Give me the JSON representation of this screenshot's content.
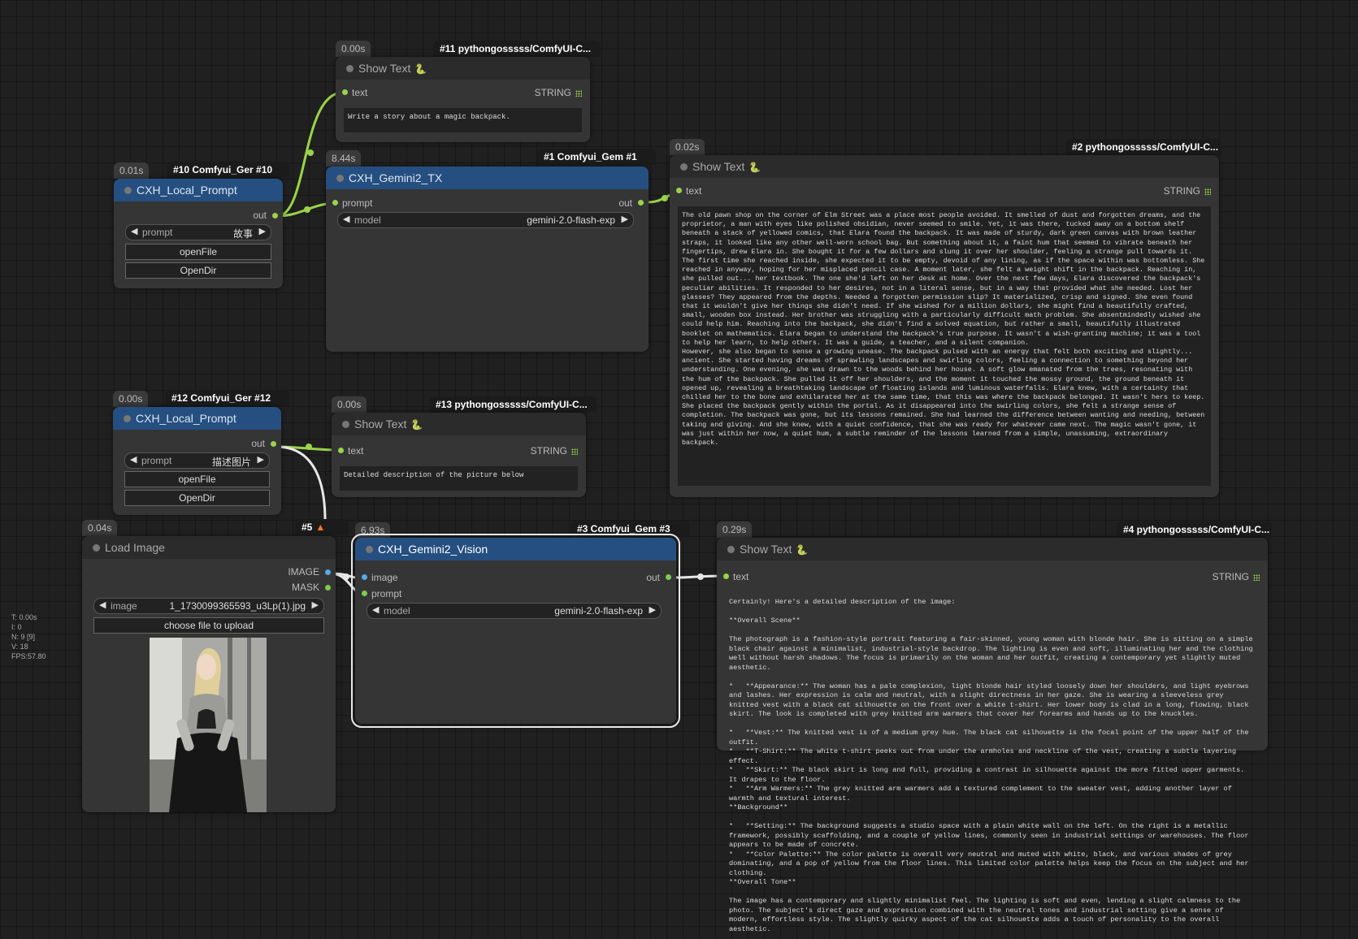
{
  "nodes": {
    "n11": {
      "time": "0.00s",
      "id_label": "#11 pythongosssss/ComfyUI-C...",
      "title": "Show Text",
      "input": "text",
      "type": "STRING",
      "content": "Write a story about a magic backpack."
    },
    "n10": {
      "time": "0.01s",
      "id_label": "#10 Comfyui_Ger #10",
      "title": "CXH_Local_Prompt",
      "output": "out",
      "prompt_label": "prompt",
      "prompt_value": "故事",
      "btn_open_file": "openFile",
      "btn_open_dir": "OpenDir"
    },
    "n1": {
      "time": "8.44s",
      "id_label": "#1 Comfyui_Gem #1",
      "title": "CXH_Gemini2_TX",
      "input": "prompt",
      "output": "out",
      "model_label": "model",
      "model_value": "gemini-2.0-flash-exp"
    },
    "n2": {
      "time": "0.02s",
      "id_label": "#2 pythongosssss/ComfyUI-C...",
      "title": "Show Text",
      "input": "text",
      "type": "STRING",
      "content": "The old pawn shop on the corner of Elm Street was a place most people avoided. It smelled of dust and forgotten dreams, and the proprietor, a man with eyes like polished obsidian, never seemed to smile. Yet, it was there, tucked away on a bottom shelf beneath a stack of yellowed comics, that Elara found the backpack. It was made of sturdy, dark green canvas with brown leather straps, it looked like any other well-worn school bag. But something about it, a faint hum that seemed to vibrate beneath her fingertips, drew Elara in. She bought it for a few dollars and slung it over her shoulder, feeling a strange pull towards it. The first time she reached inside, she expected it to be empty, devoid of any lining, as if the space within was bottomless. She reached in anyway, hoping for her misplaced pencil case. A moment later, she felt a weight shift in the backpack. Reaching in, she pulled out... her textbook. The one she'd left on her desk at home. Over the next few days, Elara discovered the backpack's peculiar abilities. It responded to her desires, not in a literal sense, but in a way that provided what she needed. Lost her glasses? They appeared from the depths. Needed a forgotten permission slip? It materialized, crisp and signed. She even found that it wouldn't give her things she didn't need. If she wished for a million dollars, she might find a beautifully crafted, small, wooden box instead. Her brother was struggling with a particularly difficult math problem. She absentmindedly wished she could help him. Reaching into the backpack, she didn't find a solved equation, but rather a small, beautifully illustrated booklet on mathematics. Elara began to understand the backpack's true purpose. It wasn't a wish-granting machine; it was a tool to help her learn, to help others. It was a guide, a teacher, and a silent companion.\nHowever, she also began to sense a growing unease. The backpack pulsed with an energy that felt both exciting and slightly... ancient. She started having dreams of sprawling landscapes and swirling colors, feeling a connection to something beyond her understanding. One evening, she was drawn to the woods behind her house. A soft glow emanated from the trees, resonating with the hum of the backpack. She pulled it off her shoulders, and the moment it touched the mossy ground, the ground beneath it opened up, revealing a breathtaking landscape of floating islands and luminous waterfalls. Elara knew, with a certainty that chilled her to the bone and exhilarated her at the same time, that this was where the backpack belonged. It wasn't hers to keep. She placed the backpack gently within the portal. As it disappeared into the swirling colors, she felt a strange sense of completion. The backpack was gone, but its lessons remained. She had learned the difference between wanting and needing, between taking and giving. And she knew, with a quiet confidence, that she was ready for whatever came next. The magic wasn't gone, it was just within her now, a quiet hum, a subtle reminder of the lessons learned from a simple, unassuming, extraordinary backpack."
    },
    "n12": {
      "time": "0.00s",
      "id_label": "#12 Comfyui_Ger #12",
      "title": "CXH_Local_Prompt",
      "output": "out",
      "prompt_label": "prompt",
      "prompt_value": "描述图片",
      "btn_open_file": "openFile",
      "btn_open_dir": "OpenDir"
    },
    "n13": {
      "time": "0.00s",
      "id_label": "#13 pythongosssss/ComfyUI-C...",
      "title": "Show Text",
      "input": "text",
      "type": "STRING",
      "content": "Detailed description of the picture below"
    },
    "n5": {
      "time": "0.04s",
      "id_label": "#5",
      "title": "Load Image",
      "out_image": "IMAGE",
      "out_mask": "MASK",
      "image_label": "image",
      "image_value": "1_1730099365593_u3Lp(1).jpg",
      "upload_label": "choose file to upload"
    },
    "n3": {
      "time": "6.93s",
      "id_label": "#3 Comfyui_Gem #3",
      "title": "CXH_Gemini2_Vision",
      "in_image": "image",
      "in_prompt": "prompt",
      "output": "out",
      "model_label": "model",
      "model_value": "gemini-2.0-flash-exp"
    },
    "n4": {
      "time": "0.29s",
      "id_label": "#4 pythongosssss/ComfyUI-C...",
      "title": "Show Text",
      "input": "text",
      "type": "STRING",
      "content": "Certainly! Here's a detailed description of the image:\n\n**Overall Scene**\n\nThe photograph is a fashion-style portrait featuring a fair-skinned, young woman with blonde hair. She is sitting on a simple black chair against a minimalist, industrial-style backdrop. The lighting is even and soft, illuminating her and the clothing well without harsh shadows. The focus is primarily on the woman and her outfit, creating a contemporary yet slightly muted aesthetic.\n\n*   **Appearance:** The woman has a pale complexion, light blonde hair styled loosely down her shoulders, and light eyebrows and lashes. Her expression is calm and neutral, with a slight directness in her gaze. She is wearing a sleeveless grey knitted vest with a black cat silhouette on the front over a white t-shirt. Her lower body is clad in a long, flowing, black skirt. The look is completed with grey knitted arm warmers that cover her forearms and hands up to the knuckles.\n\n*   **Vest:** The knitted vest is of a medium grey hue. The black cat silhouette is the focal point of the upper half of the outfit.\n*   **T-Shirt:** The white t-shirt peeks out from under the armholes and neckline of the vest, creating a subtle layering effect.\n*   **Skirt:** The black skirt is long and full, providing a contrast in silhouette against the more fitted upper garments. It drapes to the floor.\n*   **Arm Warmers:** The grey knitted arm warmers add a textured complement to the sweater vest, adding another layer of warmth and textural interest.\n**Background**\n\n*   **Setting:** The background suggests a studio space with a plain white wall on the left. On the right is a metallic framework, possibly scaffolding, and a couple of yellow lines, commonly seen in industrial settings or warehouses. The floor appears to be made of concrete.\n*   **Color Palette:** The color palette is overall very neutral and muted with white, black, and various shades of grey dominating, and a pop of yellow from the floor lines. This limited color palette helps keep the focus on the subject and her clothing.\n**Overall Tone**\n\nThe image has a contemporary and slightly minimalist feel. The lighting is soft and even, lending a slight calmness to the photo. The subject's direct gaze and expression combined with the neutral tones and industrial setting give a sense of modern, effortless style. The slightly quirky aspect of the cat silhouette adds a touch of personality to the overall aesthetic."
    }
  },
  "stats": {
    "t": "T: 0.00s",
    "i": "I: 0",
    "n": "N: 9 [9]",
    "v": "V: 18",
    "fps": "FPS:57.80"
  },
  "colors": {
    "canvas": "#202020",
    "node_body": "#353535",
    "title_bar": "#2b2b2b",
    "gemini_title": "#254f80",
    "wire_string": "#9bd34a",
    "wire_image": "#e8e8e8"
  }
}
